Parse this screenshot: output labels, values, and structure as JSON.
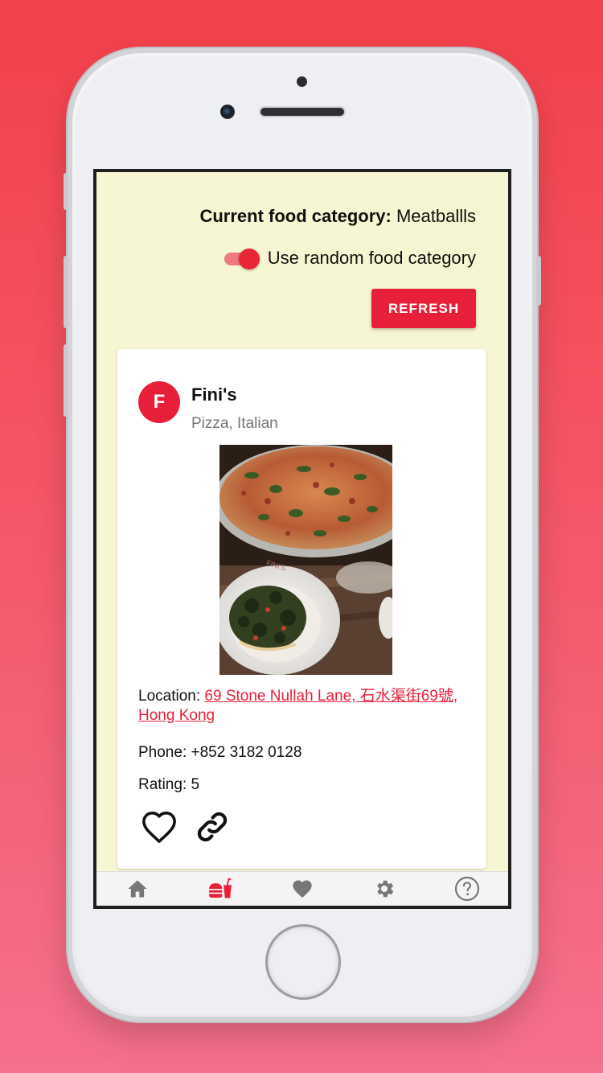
{
  "header": {
    "category_label": "Current food category:",
    "category_value": "Meatballls",
    "random_toggle_label": "Use random food category",
    "random_toggle_on": true,
    "refresh_label": "REFRESH"
  },
  "restaurant": {
    "avatar_letter": "F",
    "name": "Fini's",
    "categories": "Pizza, Italian",
    "location_label": "Location:",
    "location_value": "69 Stone Nullah Lane, 石水渠街69號, Hong Kong",
    "phone_line": "Phone: +852 3182 0128",
    "rating_line": "Rating: 5",
    "photo_plate_text": "FINI'S"
  },
  "actions": {
    "favorite_icon": "heart-outline-icon",
    "link_icon": "link-icon"
  },
  "nav": {
    "items": [
      {
        "icon": "home-icon",
        "active": false
      },
      {
        "icon": "food-icon",
        "active": true
      },
      {
        "icon": "heart-icon",
        "active": false
      },
      {
        "icon": "gear-icon",
        "active": false
      },
      {
        "icon": "help-icon",
        "active": false
      }
    ]
  },
  "colors": {
    "accent": "#e81f38",
    "app_background": "#f7f6d2",
    "nav_inactive": "#777777"
  }
}
